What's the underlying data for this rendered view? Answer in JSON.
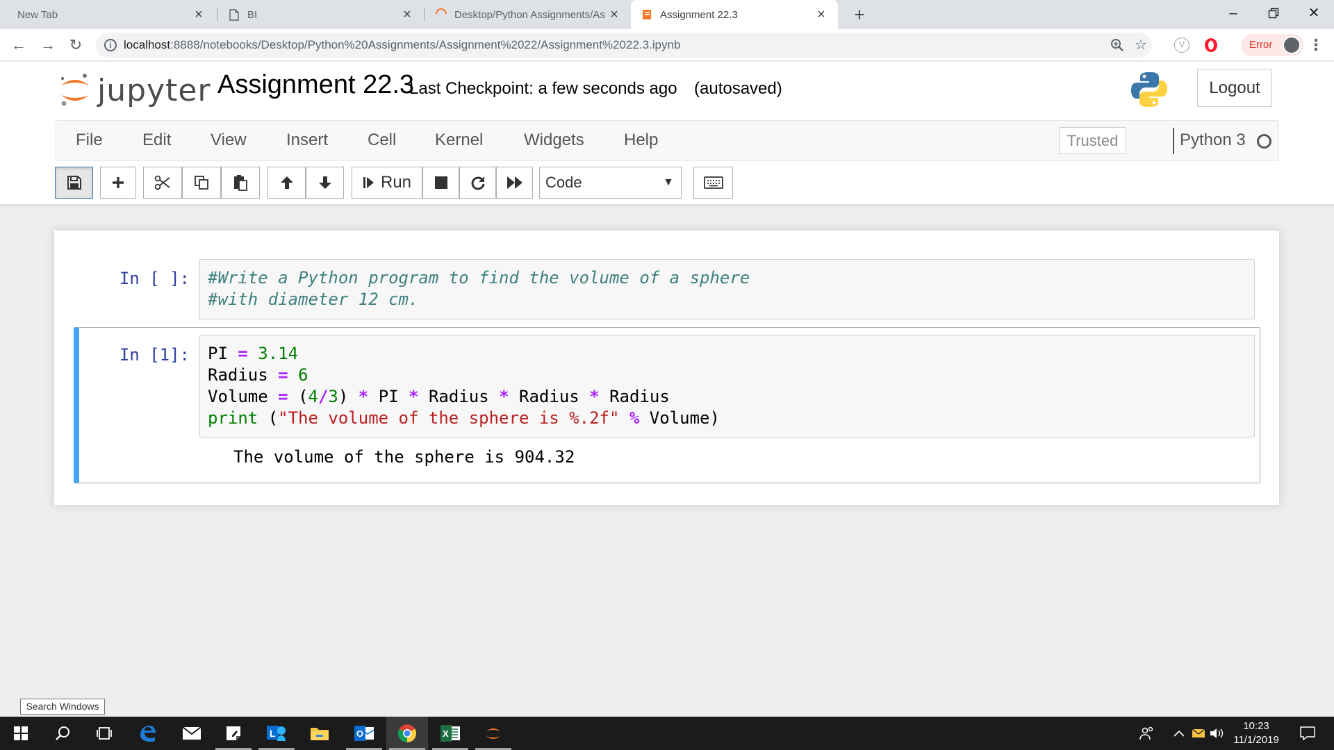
{
  "browser": {
    "tabs": [
      {
        "label": "New Tab",
        "active": false
      },
      {
        "label": "BI",
        "active": false
      },
      {
        "label": "Desktop/Python Assignments/As",
        "active": false
      },
      {
        "label": "Assignment 22.3",
        "active": true
      }
    ],
    "url_host": "localhost",
    "url_path": ":8888/notebooks/Desktop/Python%20Assignments/Assignment%2022/Assignment%2022.3.ipynb",
    "error_label": "Error"
  },
  "jupyter": {
    "logo_text": "jupyter",
    "notebook_title": "Assignment 22.3",
    "checkpoint": "Last Checkpoint: a few seconds ago",
    "autosaved": "(autosaved)",
    "logout_label": "Logout",
    "menu": [
      "File",
      "Edit",
      "View",
      "Insert",
      "Cell",
      "Kernel",
      "Widgets",
      "Help"
    ],
    "trusted_label": "Trusted",
    "kernel_name": "Python 3",
    "toolbar": {
      "run_label": "Run",
      "cell_type": "Code"
    }
  },
  "cells": [
    {
      "prompt": "In [ ]:",
      "lines": [
        "#Write a Python program to find the volume of a sphere",
        "#with diameter 12 cm."
      ]
    },
    {
      "prompt": "In [1]:",
      "tokens": {
        "l1": [
          "PI",
          "=",
          "3.14"
        ],
        "l2": [
          "Radius",
          "=",
          "6"
        ],
        "l3": [
          "Volume",
          "=",
          "(",
          "4",
          "/",
          "3",
          ")",
          "*",
          "PI",
          "*",
          "Radius",
          "*",
          "Radius",
          "*",
          "Radius"
        ],
        "l4": [
          "print",
          "(",
          "\"The volume of the sphere is %.2f\"",
          "%",
          "Volume",
          ")"
        ]
      },
      "output": "The volume of the sphere is 904.32"
    }
  ],
  "taskbar": {
    "search_tooltip": "Search Windows",
    "time": "10:23",
    "date": "11/1/2019"
  }
}
